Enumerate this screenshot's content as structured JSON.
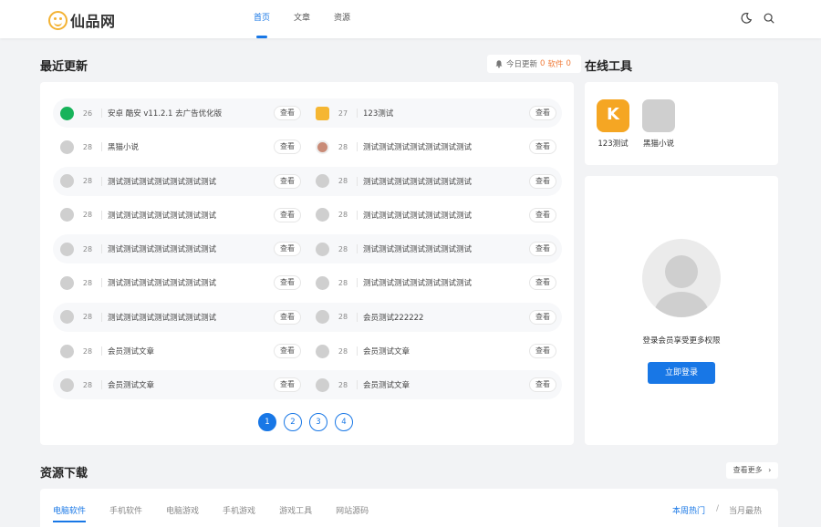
{
  "header": {
    "logo_text": "仙品网",
    "nav": [
      {
        "label": "首页",
        "active": true
      },
      {
        "label": "文章",
        "active": false
      },
      {
        "label": "资源",
        "active": false
      }
    ],
    "icons": [
      "moon-icon",
      "search-icon"
    ]
  },
  "recent": {
    "title": "最近更新",
    "badge": {
      "prefix": "今日更新",
      "count": "0",
      "mid": "软件",
      "count2": "0"
    },
    "rows": [
      [
        {
          "icon": "coolapk",
          "count": "26",
          "title": "安卓 酷安 v11.2.1 去广告优化版",
          "btn": "查看"
        },
        {
          "icon": "gift",
          "count": "27",
          "title": "123测试",
          "btn": "查看"
        }
      ],
      [
        {
          "icon": "default",
          "count": "28",
          "title": "黑猫小说",
          "btn": "查看"
        },
        {
          "icon": "pic",
          "count": "28",
          "title": "测试测试测试测试测试测试测试",
          "btn": "查看"
        }
      ],
      [
        {
          "icon": "default",
          "count": "28",
          "title": "测试测试测试测试测试测试测试",
          "btn": "查看"
        },
        {
          "icon": "default",
          "count": "28",
          "title": "测试测试测试测试测试测试测试",
          "btn": "查看"
        }
      ],
      [
        {
          "icon": "default",
          "count": "28",
          "title": "测试测试测试测试测试测试测试",
          "btn": "查看"
        },
        {
          "icon": "default",
          "count": "28",
          "title": "测试测试测试测试测试测试测试",
          "btn": "查看"
        }
      ],
      [
        {
          "icon": "default",
          "count": "28",
          "title": "测试测试测试测试测试测试测试",
          "btn": "查看"
        },
        {
          "icon": "default",
          "count": "28",
          "title": "测试测试测试测试测试测试测试",
          "btn": "查看"
        }
      ],
      [
        {
          "icon": "default",
          "count": "28",
          "title": "测试测试测试测试测试测试测试",
          "btn": "查看"
        },
        {
          "icon": "default",
          "count": "28",
          "title": "测试测试测试测试测试测试测试",
          "btn": "查看"
        }
      ],
      [
        {
          "icon": "default",
          "count": "28",
          "title": "测试测试测试测试测试测试测试",
          "btn": "查看"
        },
        {
          "icon": "default",
          "count": "28",
          "title": "会员测试222222",
          "btn": "查看"
        }
      ],
      [
        {
          "icon": "default",
          "count": "28",
          "title": "会员测试文章",
          "btn": "查看"
        },
        {
          "icon": "default",
          "count": "28",
          "title": "会员测试文章",
          "btn": "查看"
        }
      ],
      [
        {
          "icon": "default",
          "count": "28",
          "title": "会员测试文章",
          "btn": "查看"
        },
        {
          "icon": "default",
          "count": "28",
          "title": "会员测试文章",
          "btn": "查看"
        }
      ]
    ],
    "pages": [
      "1",
      "2",
      "3",
      "4"
    ],
    "current_page": "1"
  },
  "tools": {
    "title": "在线工具",
    "items": [
      {
        "label": "123测试",
        "icon": "k-app-icon"
      },
      {
        "label": "黑猫小说",
        "icon": "placeholder-icon"
      }
    ]
  },
  "login": {
    "tip": "登录会员享受更多权限",
    "button": "立即登录"
  },
  "downloads": {
    "title": "资源下载",
    "more": "查看更多",
    "tabs": [
      {
        "label": "电脑软件",
        "active": true
      },
      {
        "label": "手机软件",
        "active": false
      },
      {
        "label": "电脑游戏",
        "active": false
      },
      {
        "label": "手机游戏",
        "active": false
      },
      {
        "label": "游戏工具",
        "active": false
      },
      {
        "label": "网站源码",
        "active": false
      }
    ],
    "rank": {
      "week": "本周热门",
      "divider": "/",
      "month": "当月最热"
    }
  },
  "colors": {
    "accent": "#1877e6",
    "orange": "#f07c3a",
    "logo": "#f3b233"
  }
}
